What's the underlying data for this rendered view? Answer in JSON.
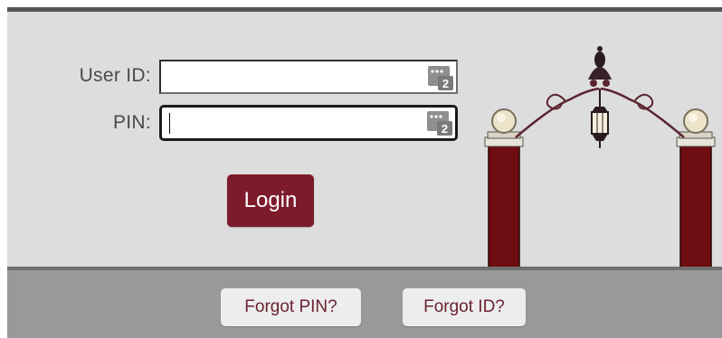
{
  "form": {
    "user_id_label": "User ID:",
    "pin_label": "PIN:",
    "user_id_value": "",
    "pin_value": "",
    "field_icon": "password-manager-icon",
    "field_icon_badge": "2"
  },
  "login_label": "Login",
  "footer": {
    "forgot_pin_label": "Forgot PIN?",
    "forgot_id_label": "Forgot ID?"
  },
  "colors": {
    "accent": "#7d1b2b",
    "link_text": "#6b2332",
    "background": "#dddddd",
    "footer": "#999999"
  }
}
